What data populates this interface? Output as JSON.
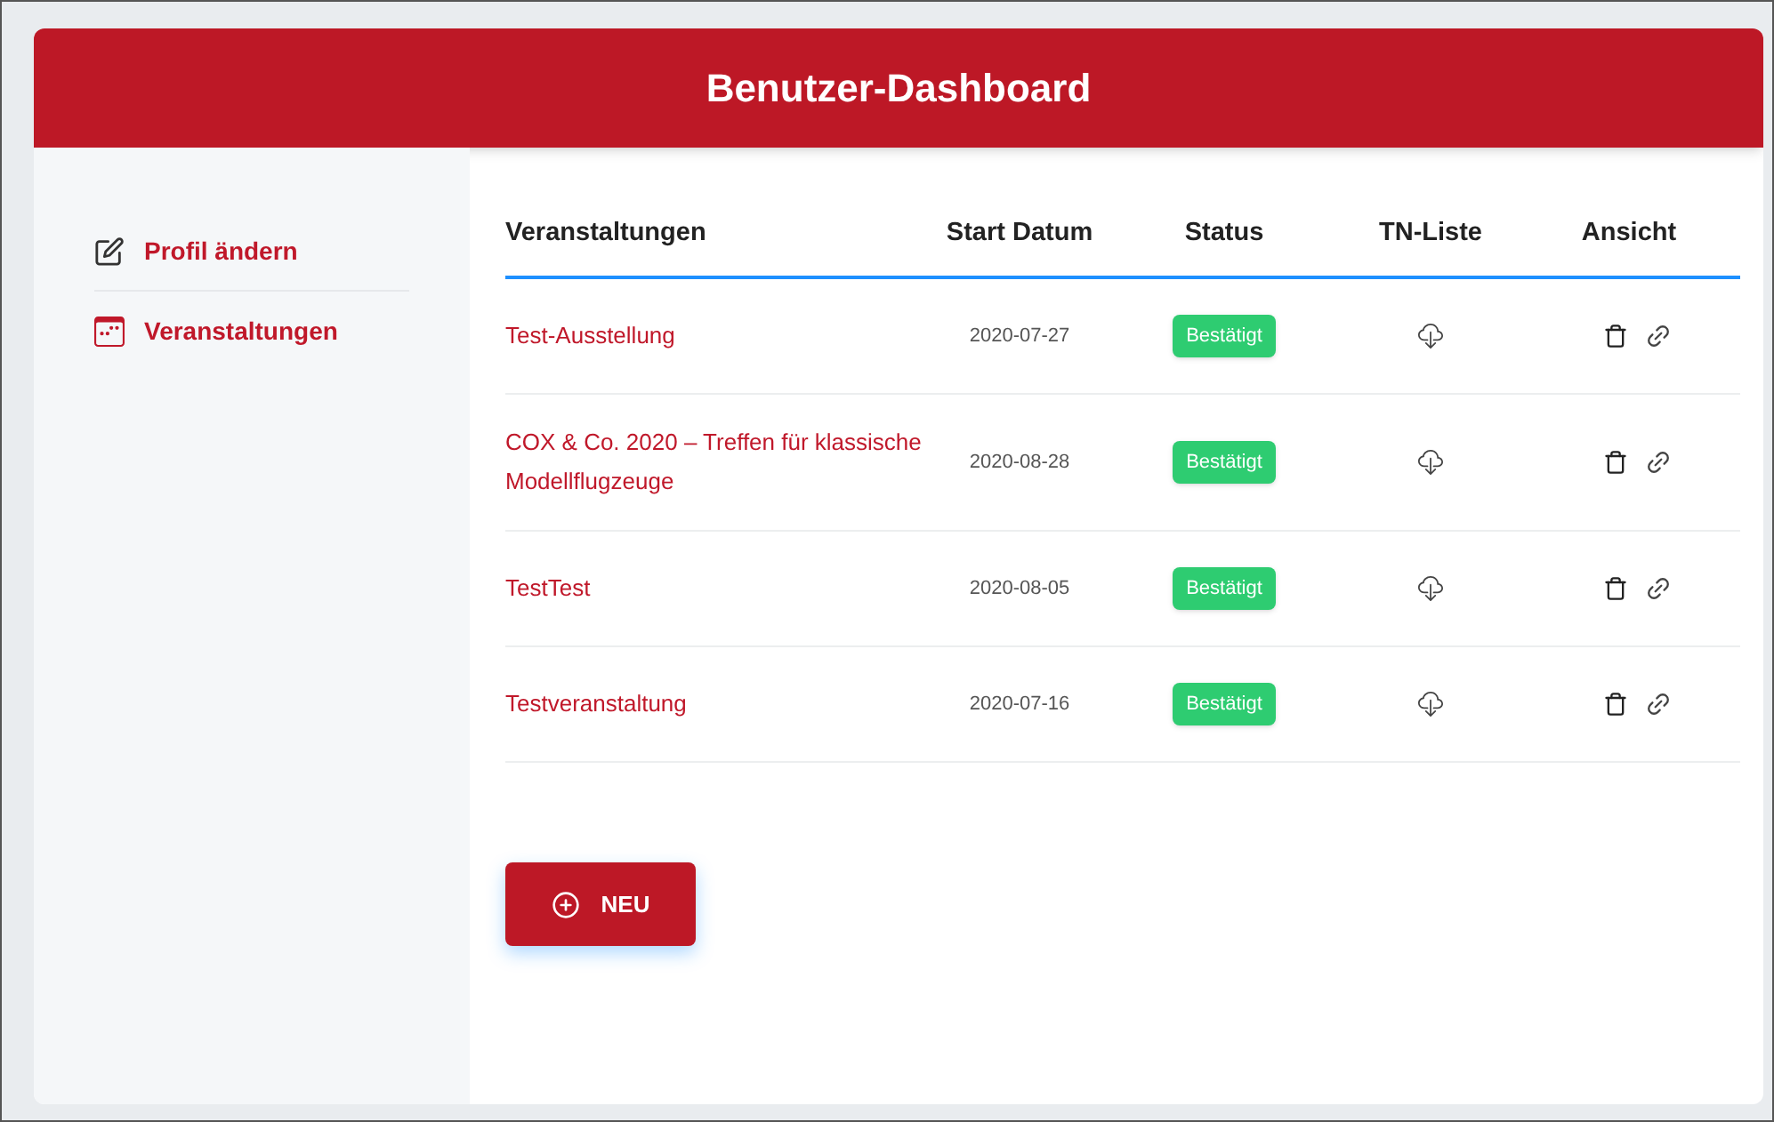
{
  "header": {
    "title": "Benutzer-Dashboard"
  },
  "sidebar": {
    "items": [
      {
        "label": "Profil ändern",
        "kind": "edit"
      },
      {
        "label": "Veranstaltungen",
        "kind": "calendar"
      }
    ]
  },
  "table": {
    "columns": [
      "Veranstaltungen",
      "Start Datum",
      "Status",
      "TN-Liste",
      "Ansicht"
    ],
    "rows": [
      {
        "name": "Test-Ausstellung",
        "date": "2020-07-27",
        "status": {
          "label": "Bestätigt",
          "kind": "confirmed"
        }
      },
      {
        "name": "COX & Co. 2020 – Treffen für klassische Modellflugzeuge",
        "date": "2020-08-28",
        "status": {
          "label": "Bestätigt",
          "kind": "confirmed"
        }
      },
      {
        "name": "TestTest",
        "date": "2020-08-05",
        "status": {
          "label": "Bestätigt",
          "kind": "confirmed"
        }
      },
      {
        "name": "Testveranstaltung",
        "date": "2020-07-16",
        "status": {
          "label": "Bestätigt",
          "kind": "confirmed"
        }
      }
    ]
  },
  "new_button": {
    "label": "NEU"
  }
}
